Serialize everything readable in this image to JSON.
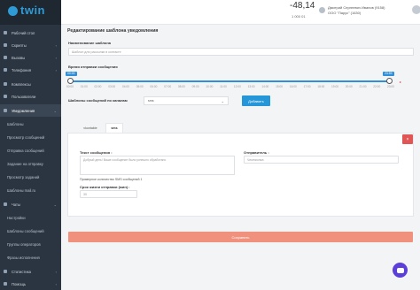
{
  "app": {
    "logo_text": "twin"
  },
  "header": {
    "balance": "-48,14",
    "balance_sub": "1 000 01",
    "user_name": "Дмитрий Сергеевич Иванов (9158)",
    "user_org": "ООО \"Парус\" (1630)"
  },
  "sidebar": {
    "items": [
      {
        "label": "Рабочий стол"
      },
      {
        "label": "Скрипты"
      },
      {
        "label": "Вызовы"
      },
      {
        "label": "Телефония"
      },
      {
        "label": "Комплексы"
      },
      {
        "label": "Пользователи"
      },
      {
        "label": "Уведомления"
      },
      {
        "label": "Шаблоны"
      },
      {
        "label": "Просмотр сообщений"
      },
      {
        "label": "Отправка сообщений"
      },
      {
        "label": "Задание на отправку"
      },
      {
        "label": "Просмотр заданий"
      },
      {
        "label": "Шаблоны mail.ru"
      },
      {
        "label": "Чаты"
      },
      {
        "label": "Настройки"
      },
      {
        "label": "Шаблоны сообщений"
      },
      {
        "label": "Группы операторов"
      },
      {
        "label": "Фразы исполнения"
      },
      {
        "label": "Статистика"
      },
      {
        "label": "Помощь"
      }
    ]
  },
  "page": {
    "title": "Редактирование шаблона уведомления"
  },
  "form": {
    "name_label": "Наименование шаблона",
    "name_placeholder": "Шаблон для рассылки в контакте",
    "time_label": "Время отправки сообщения",
    "time_start": "00:00",
    "time_end": "23:59",
    "ticks": [
      "00:00",
      "01:00",
      "02:00",
      "03:00",
      "04:00",
      "05:00",
      "06:00",
      "07:00",
      "08:00",
      "09:00",
      "10:00",
      "11:00",
      "12:00",
      "13:00",
      "14:00",
      "15:00",
      "16:00",
      "17:00",
      "18:00",
      "19:00",
      "20:00",
      "21:00",
      "22:00",
      "23:00"
    ],
    "channel_label": "Шаблоны сообщений по каналам",
    "channel_value": "sms",
    "add_button": "Добавить",
    "tabs": [
      "vkontakte",
      "sms"
    ],
    "remove_button": "×",
    "text_label": "Текст сообщения :",
    "text_value": "Добрый день! Ваше сообщение было успешно обработано",
    "sender_label": "Отправитель :",
    "sender_value": "Чемпионка",
    "count_note": "Примерное количество SMS сообщений 1",
    "ttl_label": "Срок жизни отправки (мин) :",
    "ttl_value": "30",
    "save_button": "Сохранить"
  }
}
